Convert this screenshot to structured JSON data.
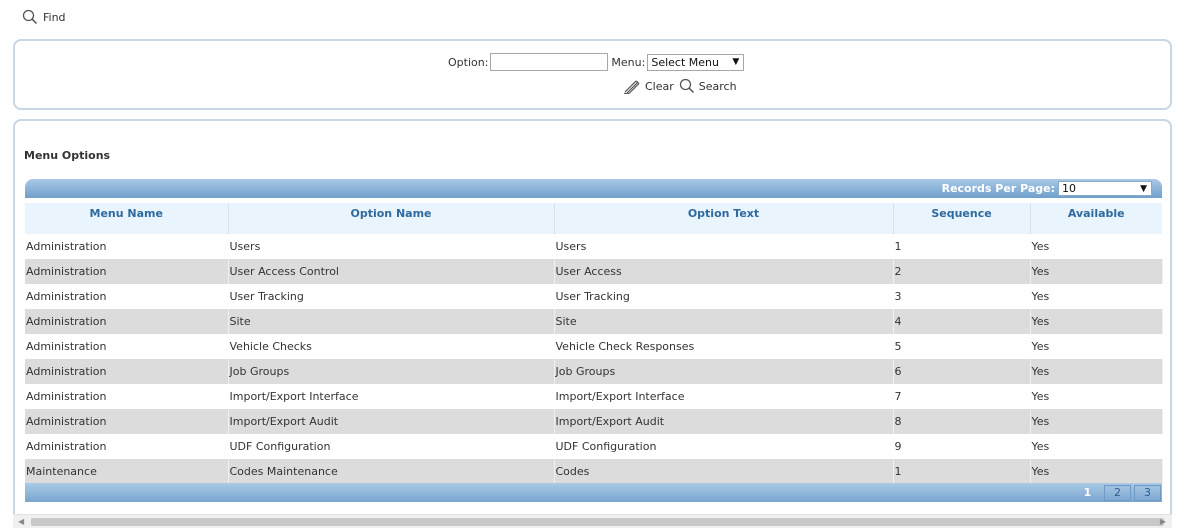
{
  "header": {
    "find_label": "Find"
  },
  "filter": {
    "option_label": "Option:",
    "option_value": "",
    "menu_label": "Menu:",
    "menu_selected": "Select Menu",
    "clear_label": "Clear",
    "search_label": "Search"
  },
  "results": {
    "title": "Menu Options",
    "records_per_page_label": "Records Per Page:",
    "records_per_page_value": "10",
    "columns": [
      "Menu Name",
      "Option Name",
      "Option Text",
      "Sequence",
      "Available"
    ],
    "rows": [
      [
        "Administration",
        "Users",
        "Users",
        "1",
        "Yes"
      ],
      [
        "Administration",
        "User Access Control",
        "User Access",
        "2",
        "Yes"
      ],
      [
        "Administration",
        "User Tracking",
        "User Tracking",
        "3",
        "Yes"
      ],
      [
        "Administration",
        "Site",
        "Site",
        "4",
        "Yes"
      ],
      [
        "Administration",
        "Vehicle Checks",
        "Vehicle Check Responses",
        "5",
        "Yes"
      ],
      [
        "Administration",
        "Job Groups",
        "Job Groups",
        "6",
        "Yes"
      ],
      [
        "Administration",
        "Import/Export Interface",
        "Import/Export Interface",
        "7",
        "Yes"
      ],
      [
        "Administration",
        "Import/Export Audit",
        "Import/Export Audit",
        "8",
        "Yes"
      ],
      [
        "Administration",
        "UDF Configuration",
        "UDF Configuration",
        "9",
        "Yes"
      ],
      [
        "Maintenance",
        "Codes Maintenance",
        "Codes",
        "1",
        "Yes"
      ]
    ],
    "pages": [
      "1",
      "2",
      "3"
    ],
    "current_page": "1"
  },
  "icons": {
    "find": "search-icon",
    "clear": "eraser-icon",
    "search": "search-icon",
    "dropdown": "caret-down-icon"
  }
}
